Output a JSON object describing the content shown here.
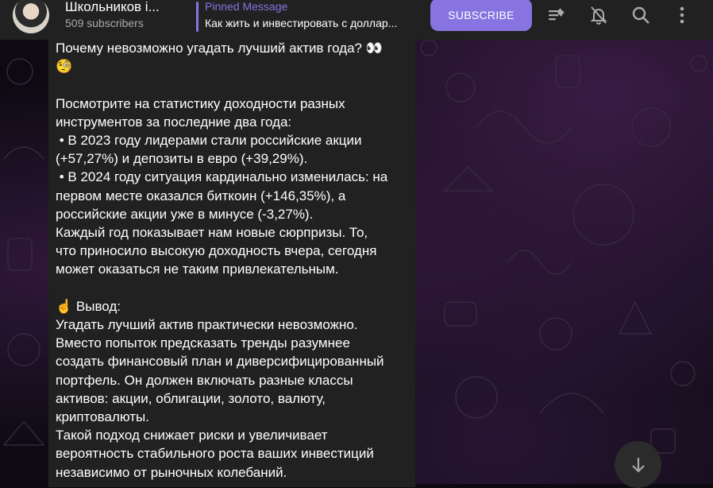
{
  "channel": {
    "title": "Школьников і...",
    "subscribers": "509 subscribers"
  },
  "pinned": {
    "label": "Pinned Message",
    "text": "Как жить и инвестировать с доллар..."
  },
  "header_actions": {
    "subscribe_label": "SUBSCRIBE",
    "icons": [
      "pin-list-icon",
      "mute-bell-icon",
      "search-icon",
      "more-vertical-icon"
    ]
  },
  "message": {
    "lines": [
      "Почему невозможно угадать лучший актив года? 👀",
      "🧐",
      "",
      "Посмотрите на статистику доходности разных",
      "инструментов за последние два года:",
      " • В 2023 году лидерами стали российские акции",
      "(+57,27%) и депозиты в евро (+39,29%).",
      " • В 2024 году ситуация кардинально изменилась: на",
      "первом месте оказался биткоин (+146,35%), а",
      "российские акции уже в минусе (-3,27%).",
      "Каждый год показывает нам новые сюрпризы. То,",
      "что приносило высокую доходность вчера, сегодня",
      "может оказаться не таким привлекательным.",
      "",
      "☝️ Вывод:",
      "Угадать лучший актив практически невозможно.",
      "Вместо попыток предсказать тренды разумнее",
      "создать финансовый план и диверсифицированный",
      "портфель. Он должен включать разные классы",
      "активов: акции, облигации, золото, валюту,",
      "криптовалюты.",
      "Такой подход снижает риски и увеличивает",
      "вероятность стабильного роста ваших инвестиций",
      "независимо от рыночных колебаний."
    ]
  },
  "colors": {
    "accent": "#8774e1",
    "header_bg": "#212121",
    "bubble_bg": "#212121",
    "secondary_text": "#aaaaaa"
  }
}
